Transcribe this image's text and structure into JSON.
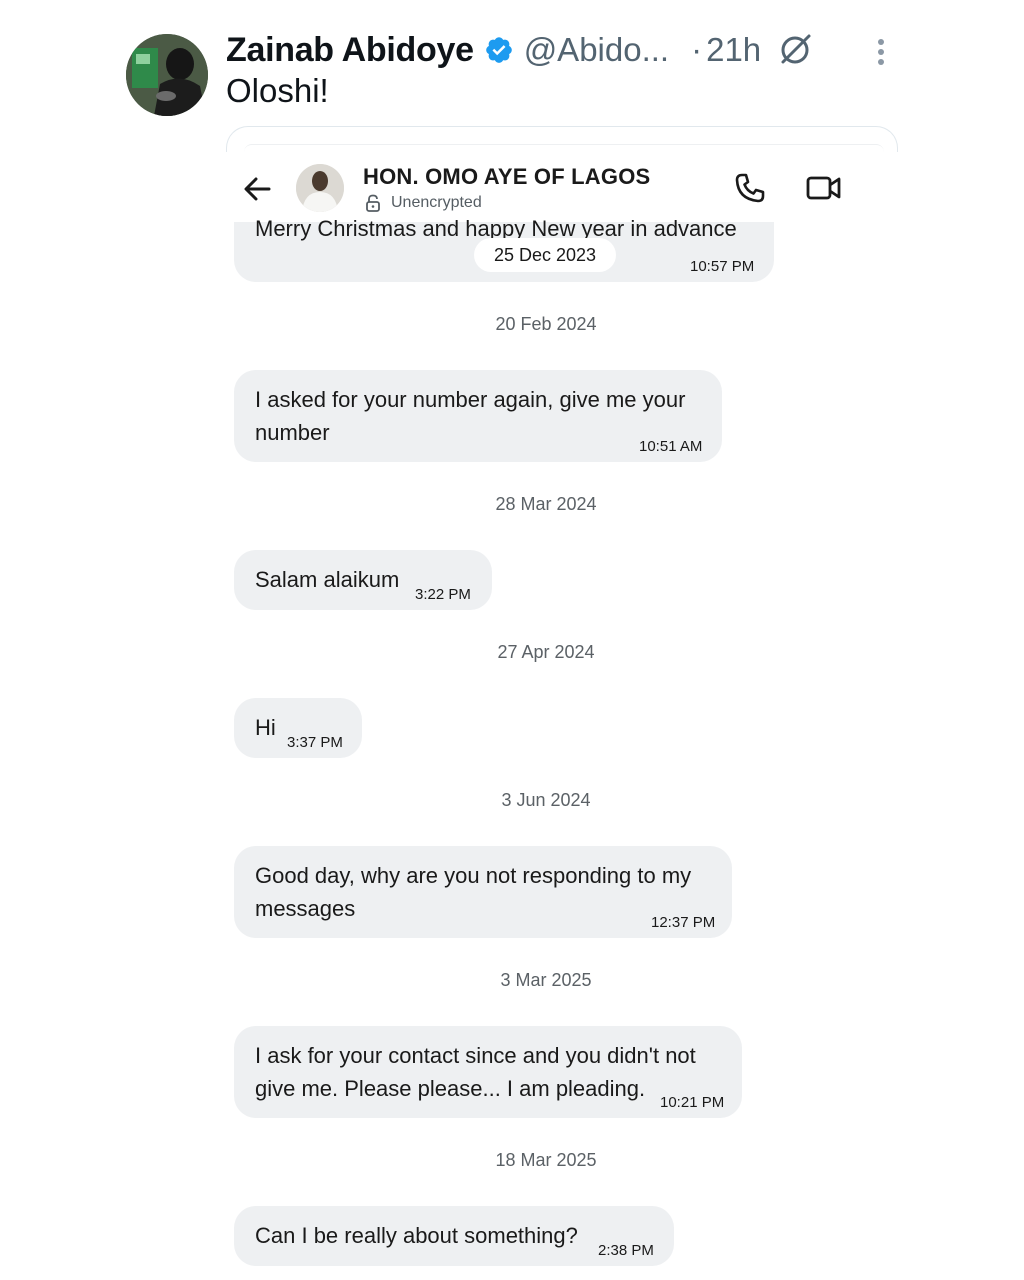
{
  "tweet": {
    "author_name": "Zainab Abidoye",
    "handle": "@Abido...",
    "dot": "·",
    "time_ago": "21h",
    "text": "Oloshi!"
  },
  "chat": {
    "contact_name": "HON. OMO AYE OF LAGOS",
    "encryption_label": "Unencrypted",
    "pinned_date": "25 Dec 2023",
    "messages": [
      {
        "lines": [
          "Merry Christmas and happy New year in advance"
        ],
        "time": "10:57 PM"
      },
      {
        "date": "20 Feb 2024",
        "lines": [
          "I asked for your number again, give me your",
          "number"
        ],
        "time": "10:51 AM"
      },
      {
        "date": "28 Mar 2024",
        "lines": [
          "Salam alaikum"
        ],
        "time": "3:22 PM"
      },
      {
        "date": "27 Apr 2024",
        "lines": [
          "Hi"
        ],
        "time": "3:37 PM"
      },
      {
        "date": "3 Jun 2024",
        "lines": [
          "Good day, why are you not responding to my",
          "messages"
        ],
        "time": "12:37 PM"
      },
      {
        "date": "3 Mar 2025",
        "lines": [
          "I ask for your contact since and you didn't not",
          "give me. Please please... I am pleading."
        ],
        "time": "10:21 PM"
      },
      {
        "date": "18 Mar 2025",
        "lines": [
          "Can I be really about something?"
        ],
        "time": "2:38 PM"
      }
    ]
  },
  "icons": {
    "verified": "verified-badge-icon",
    "grok": "grok-icon",
    "more": "more-options-icon",
    "back": "back-arrow-icon",
    "lock": "lock-icon",
    "call": "phone-call-icon",
    "video": "video-call-icon"
  },
  "colors": {
    "verified_blue": "#1d9bf0",
    "bubble_bg": "#eef0f2",
    "muted_text": "#536471"
  }
}
